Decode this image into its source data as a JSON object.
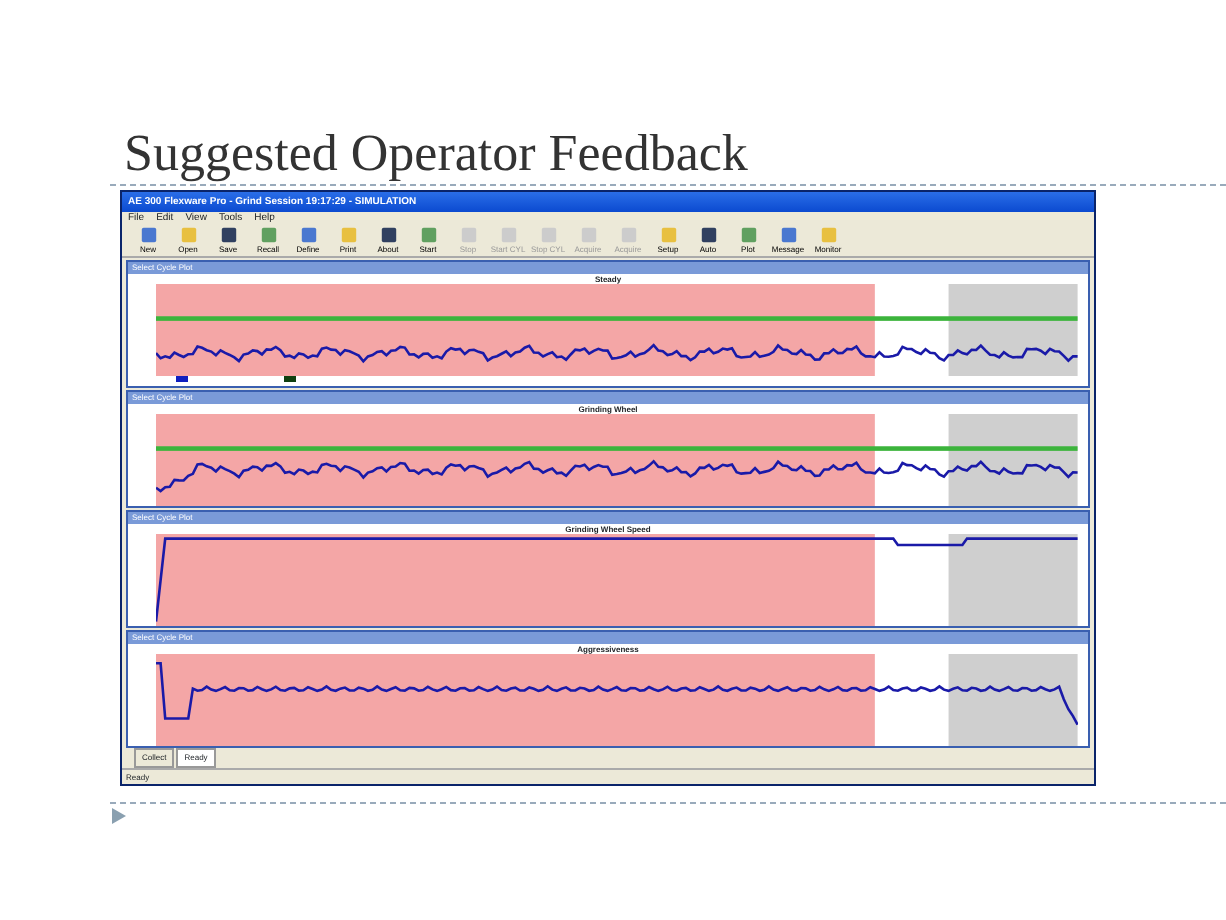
{
  "slide": {
    "title": "Suggested Operator Feedback"
  },
  "window": {
    "title": "AE 300 Flexware Pro - Grind Session 19:17:29 - SIMULATION"
  },
  "menu": [
    "File",
    "Edit",
    "View",
    "Tools",
    "Help"
  ],
  "toolbar": [
    {
      "label": "New",
      "disabled": false
    },
    {
      "label": "Open",
      "disabled": false
    },
    {
      "label": "Save",
      "disabled": false
    },
    {
      "label": "Recall",
      "disabled": false
    },
    {
      "label": "Define",
      "disabled": false
    },
    {
      "label": "Print",
      "disabled": false
    },
    {
      "label": "About",
      "disabled": false
    },
    {
      "label": "Start",
      "disabled": false
    },
    {
      "label": "Stop",
      "disabled": true
    },
    {
      "label": "Start CYL",
      "disabled": true
    },
    {
      "label": "Stop CYL",
      "disabled": true
    },
    {
      "label": "Acquire",
      "disabled": true
    },
    {
      "label": "Acquire",
      "disabled": true
    },
    {
      "label": "Setup",
      "disabled": false
    },
    {
      "label": "Auto",
      "disabled": false
    },
    {
      "label": "Plot",
      "disabled": false
    },
    {
      "label": "Message",
      "disabled": false
    },
    {
      "label": "Monitor",
      "disabled": false
    }
  ],
  "panels": [
    {
      "header": "Select Cycle Plot",
      "title": "Steady",
      "kind": "steady",
      "limit_line": true,
      "legend": [
        {
          "color": "#1020c0"
        },
        {
          "color": "#104010"
        }
      ]
    },
    {
      "header": "Select Cycle Plot",
      "title": "Grinding Wheel",
      "kind": "wheel",
      "limit_line": true
    },
    {
      "header": "Select Cycle Plot",
      "title": "Grinding Wheel Speed",
      "kind": "speed",
      "limit_line": false
    },
    {
      "header": "Select Cycle Plot",
      "title": "Aggressiveness",
      "kind": "aggr",
      "limit_line": false
    }
  ],
  "tabs": [
    {
      "label": "Collect",
      "selected": false
    },
    {
      "label": "Ready",
      "selected": true
    }
  ],
  "status_bar": "Ready"
}
